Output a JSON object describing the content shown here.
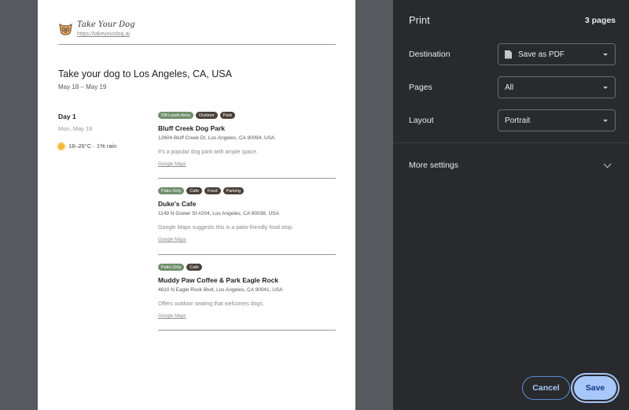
{
  "preview": {
    "brand": {
      "name": "Take Your Dog",
      "url": "https://takeyourdog.ai"
    },
    "trip": {
      "title": "Take your dog to Los Angeles, CA, USA",
      "dates": "May 18 – May 19"
    },
    "day": {
      "label": "Day 1",
      "date": "Mon, May 18",
      "weather": "18–26°C · 1% rain"
    },
    "places": [
      {
        "tags": [
          {
            "label": "Off-Leash Area",
            "style": "green"
          },
          {
            "label": "Outdoor",
            "style": "dark"
          },
          {
            "label": "Park",
            "style": "dark"
          }
        ],
        "name": "Bluff Creek Dog Park",
        "address": "12604 Bluff Creek Dr, Los Angeles, CA 90094, USA",
        "description": "It's a popular dog park with ample space.",
        "link": "Google Maps"
      },
      {
        "tags": [
          {
            "label": "Patio Only",
            "style": "green"
          },
          {
            "label": "Cafe",
            "style": "dark"
          },
          {
            "label": "Food",
            "style": "dark"
          },
          {
            "label": "Parking",
            "style": "dark"
          }
        ],
        "name": "Duke's Cafe",
        "address": "1149 N Gower St #204, Los Angeles, CA 90038, USA",
        "description": "Google Maps suggests this is a patio-friendly food stop.",
        "link": "Google Maps"
      },
      {
        "tags": [
          {
            "label": "Patio Only",
            "style": "green"
          },
          {
            "label": "Cafe",
            "style": "dark"
          }
        ],
        "name": "Muddy Paw Coffee & Park Eagle Rock",
        "address": "4610 N Eagle Rock Blvd, Los Angeles, CA 90041, USA",
        "description": "Offers outdoor seating that welcomes dogs.",
        "link": "Google Maps"
      }
    ]
  },
  "print_panel": {
    "title": "Print",
    "page_count": "3 pages",
    "destination": {
      "label": "Destination",
      "value": "Save as PDF",
      "icon": "document-icon"
    },
    "pages": {
      "label": "Pages",
      "value": "All"
    },
    "layout": {
      "label": "Layout",
      "value": "Portrait"
    },
    "more_settings": "More settings",
    "cancel_label": "Cancel",
    "save_label": "Save"
  },
  "colors": {
    "panel_bg": "#292a2d",
    "accent": "#a8c7fa",
    "tag_green": "#6f8f6a",
    "tag_dark": "#4b4038"
  }
}
